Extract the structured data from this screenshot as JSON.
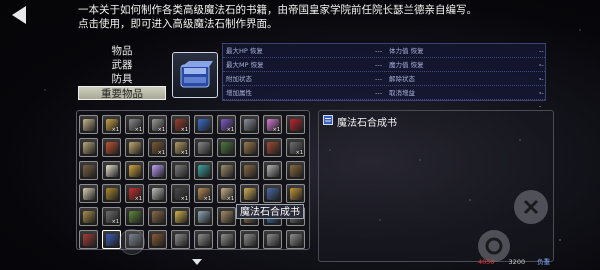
{
  "description": {
    "line1": "一本关于如何制作各类高级魔法石的书籍，由帝国皇家学院前任院长瑟兰德亲自编写。",
    "line2": "点击使用，即可进入高级魔法石制作界面。"
  },
  "categories": [
    {
      "label": "物品",
      "active": false
    },
    {
      "label": "武器",
      "active": false
    },
    {
      "label": "防具",
      "active": false
    },
    {
      "label": "重要物品",
      "active": true
    }
  ],
  "stats": [
    {
      "left_label": "最大HP 恢复",
      "left_value": "---",
      "right_label": "体力值 恢复",
      "right_value": "---"
    },
    {
      "left_label": "最大MP 恢复",
      "left_value": "---",
      "right_label": "魔力值 恢复",
      "right_value": "---"
    },
    {
      "left_label": "附加状态",
      "left_value": "---",
      "right_label": "解除状态",
      "right_value": "---"
    },
    {
      "left_label": "增加属性",
      "left_value": "---",
      "right_label": "取消增益",
      "right_value": "---"
    }
  ],
  "inventory": [
    {
      "icon": "scroll-icon",
      "qty": "",
      "color": "#c7b78e"
    },
    {
      "icon": "herb-icon",
      "qty": "×1",
      "color": "#c9a245"
    },
    {
      "icon": "gear-stone-icon",
      "qty": "×1",
      "color": "#8a8a8a"
    },
    {
      "icon": "wand-icon",
      "qty": "×1",
      "color": "#9b9b9b"
    },
    {
      "icon": "potion-red-icon",
      "qty": "×1",
      "color": "#9b3d2c"
    },
    {
      "icon": "orb-blue-icon",
      "qty": "",
      "color": "#3b6fd1"
    },
    {
      "icon": "orb-purple-icon",
      "qty": "×1",
      "color": "#8059c8"
    },
    {
      "icon": "tome-icon",
      "qty": "",
      "color": "#8a8f9a"
    },
    {
      "icon": "crystal-pink-icon",
      "qty": "×1",
      "color": "#d67ad6"
    },
    {
      "icon": "rose-icon",
      "qty": "",
      "color": "#c0262e"
    },
    {
      "icon": "bowl-icon",
      "qty": "",
      "color": "#b7a77b"
    },
    {
      "icon": "scroll-red-icon",
      "qty": "",
      "color": "#c2552f"
    },
    {
      "icon": "map-icon",
      "qty": "",
      "color": "#c3a96f"
    },
    {
      "icon": "book-brown-icon",
      "qty": "×1",
      "color": "#7b5a32"
    },
    {
      "icon": "cards-icon",
      "qty": "×1",
      "color": "#b49b64"
    },
    {
      "icon": "dagger-icon",
      "qty": "",
      "color": "#888888"
    },
    {
      "icon": "box-green-icon",
      "qty": "",
      "color": "#4d7a3e"
    },
    {
      "icon": "crate-icon",
      "qty": "",
      "color": "#9c7b4a"
    },
    {
      "icon": "drum-icon",
      "qty": "",
      "color": "#a34a33"
    },
    {
      "icon": "rune-icon",
      "qty": "×1",
      "color": "#6d6d6d"
    },
    {
      "icon": "bookshelf-icon",
      "qty": "",
      "color": "#7a6346"
    },
    {
      "icon": "candle-icon",
      "qty": "",
      "color": "#e8e1cf"
    },
    {
      "icon": "key-gold-icon",
      "qty": "",
      "color": "#d4a53a"
    },
    {
      "icon": "moon-icon",
      "qty": "",
      "color": "#bfa0ff"
    },
    {
      "icon": "claw-icon",
      "qty": "",
      "color": "#7e7e7e"
    },
    {
      "icon": "book-teal-icon",
      "qty": "",
      "color": "#3aa3a0"
    },
    {
      "icon": "tablet-icon",
      "qty": "",
      "color": "#9e8e6b"
    },
    {
      "icon": "bag-icon",
      "qty": "",
      "color": "#8a6a44"
    },
    {
      "icon": "sword-icon",
      "qty": "",
      "color": "#b5b5b5"
    },
    {
      "icon": "chest-icon",
      "qty": "",
      "color": "#8d6b3f"
    },
    {
      "icon": "bone-icon",
      "qty": "",
      "color": "#d9cfb8"
    },
    {
      "icon": "coin-icon",
      "qty": "",
      "color": "#b08a2e"
    },
    {
      "icon": "vial-red-icon",
      "qty": "×1",
      "color": "#c8302e"
    },
    {
      "icon": "feather-icon",
      "qty": "",
      "color": "#c0c0c0"
    },
    {
      "icon": "gem-dark-icon",
      "qty": "×1",
      "color": "#4a4a4a"
    },
    {
      "icon": "horn-icon",
      "qty": "×1",
      "color": "#b58a54"
    },
    {
      "icon": "scroll-tan-icon",
      "qty": "×1",
      "color": "#c9b089"
    },
    {
      "icon": "lantern-icon",
      "qty": "",
      "color": "#d4b15b"
    },
    {
      "icon": "book-blue-icon",
      "qty": "",
      "color": "#4a6aa8"
    },
    {
      "icon": "chest-gold-icon",
      "qty": "",
      "color": "#c49638"
    },
    {
      "icon": "ring-icon",
      "qty": "",
      "color": "#a88e4a"
    },
    {
      "icon": "cube-icon",
      "qty": "×1",
      "color": "#6e6e6e"
    },
    {
      "icon": "leaf-icon",
      "qty": "",
      "color": "#5f8a3a"
    },
    {
      "icon": "pouch-icon",
      "qty": "",
      "color": "#8b6a45"
    },
    {
      "icon": "crown-icon",
      "qty": "",
      "color": "#d2b44b"
    },
    {
      "icon": "flask-icon",
      "qty": "",
      "color": "#8fa7b8"
    },
    {
      "icon": "relic-icon",
      "qty": "",
      "color": "#a58d67"
    },
    {
      "icon": "box-icon",
      "qty": "",
      "color": "#9b7b55"
    },
    {
      "icon": "gem-blue-icon",
      "qty": "",
      "color": "#3d7fc8"
    },
    {
      "icon": "stone-icon",
      "qty": "",
      "color": "#7a7a7a"
    },
    {
      "icon": "tome-red-icon",
      "qty": "",
      "color": "#a83c34"
    },
    {
      "icon": "magic-stone-book-icon",
      "qty": "",
      "color": "#3a5fb8"
    },
    {
      "icon": "tome-grey-icon",
      "qty": "",
      "color": "#7d8590"
    },
    {
      "icon": "leather-book-icon",
      "qty": "",
      "color": "#8b5a35"
    },
    {
      "icon": "book-stack-icon",
      "qty": "",
      "color": "#8e8e8e"
    },
    {
      "icon": "book-stack-icon",
      "qty": "",
      "color": "#8e8e8e"
    },
    {
      "icon": "book-stack-icon",
      "qty": "",
      "color": "#8e8e8e"
    },
    {
      "icon": "book-stack-icon",
      "qty": "",
      "color": "#8e8e8e"
    },
    {
      "icon": "book-stack-icon",
      "qty": "",
      "color": "#8e8e8e"
    },
    {
      "icon": "book-stack-icon",
      "qty": "",
      "color": "#8e8e8e"
    },
    {
      "icon": "book-stack-icon",
      "qty": "",
      "color": "#8e8e8e"
    },
    {
      "icon": "book-stack-icon",
      "qty": "",
      "color": "#8e8e8e"
    },
    {
      "icon": "book-stack-icon",
      "qty": "",
      "color": "#8e8e8e"
    },
    {
      "icon": "book-stack-icon",
      "qty": "",
      "color": "#8e8e8e"
    }
  ],
  "selected_index": 51,
  "tooltip_text": "魔法石合成书",
  "detail": {
    "title": "魔法石合成书"
  },
  "weight": {
    "current": "4050",
    "max": "3200",
    "label": "负重"
  }
}
